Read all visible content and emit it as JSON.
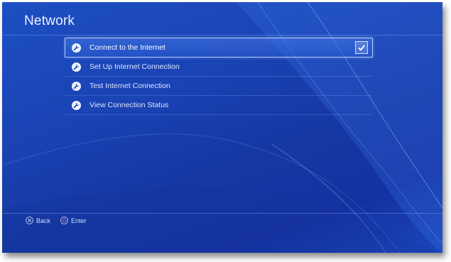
{
  "header": {
    "title": "Network"
  },
  "menu": {
    "items": [
      {
        "label": "Connect to the Internet",
        "icon": "wrench-icon",
        "checked": true
      },
      {
        "label": "Set Up Internet Connection",
        "icon": "wrench-icon"
      },
      {
        "label": "Test Internet Connection",
        "icon": "wrench-icon"
      },
      {
        "label": "View Connection Status",
        "icon": "wrench-icon"
      }
    ]
  },
  "footer": {
    "back_label": "Back",
    "enter_label": "Enter"
  },
  "colors": {
    "background": "#1a43b4",
    "accent": "#eef3ff"
  }
}
